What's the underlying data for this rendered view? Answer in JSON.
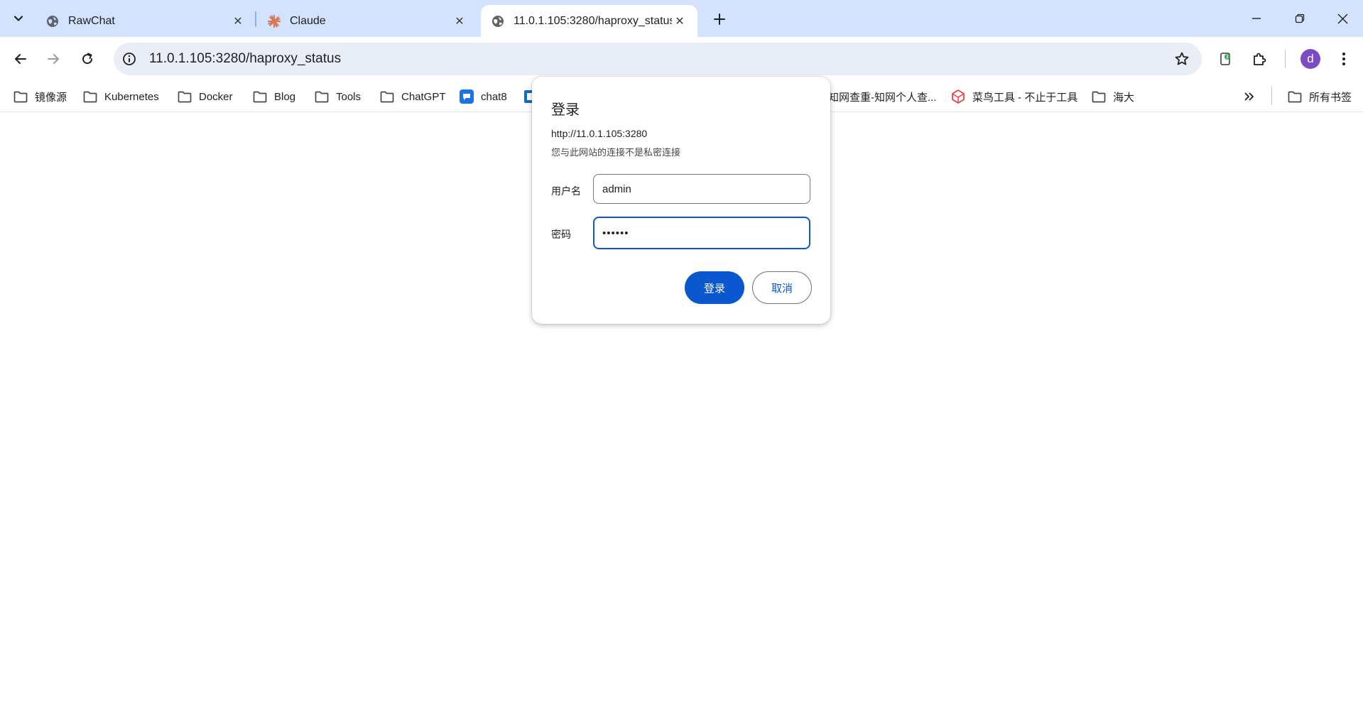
{
  "tabs": [
    {
      "title": "RawChat",
      "favicon": "globe-icon",
      "active": false
    },
    {
      "title": "Claude",
      "favicon": "claude-icon",
      "active": false
    },
    {
      "title": "11.0.1.105:3280/haproxy_status",
      "favicon": "globe-icon",
      "active": true
    }
  ],
  "omnibox": {
    "url": "11.0.1.105:3280/haproxy_status"
  },
  "profile": {
    "initial": "d",
    "color": "#7b4cc2"
  },
  "bookmarks": [
    {
      "label": "镜像源",
      "icon": "folder-icon"
    },
    {
      "label": "Kubernetes",
      "icon": "folder-icon"
    },
    {
      "label": "Docker",
      "icon": "folder-icon"
    },
    {
      "label": "Blog",
      "icon": "folder-icon"
    },
    {
      "label": "Tools",
      "icon": "folder-icon"
    },
    {
      "label": "ChatGPT",
      "icon": "folder-icon"
    },
    {
      "label": "chat8",
      "icon": "chat-icon"
    },
    {
      "label": "知网查重-知网个人查...",
      "icon": "site-icon"
    },
    {
      "label": "菜鸟工具 - 不止于工具",
      "icon": "runoob-icon"
    },
    {
      "label": "海大",
      "icon": "folder-icon"
    }
  ],
  "all_bookmarks": "所有书签",
  "dialog": {
    "title": "登录",
    "origin": "http://11.0.1.105:3280",
    "warning": "您与此网站的连接不是私密连接",
    "username_label": "用户名",
    "username_value": "admin",
    "password_label": "密码",
    "password_value": "••••••",
    "login_button": "登录",
    "cancel_button": "取消"
  },
  "colors": {
    "accent": "#0b57d0",
    "tabstrip": "#d3e3fd",
    "omnibox": "#e9eef6"
  }
}
